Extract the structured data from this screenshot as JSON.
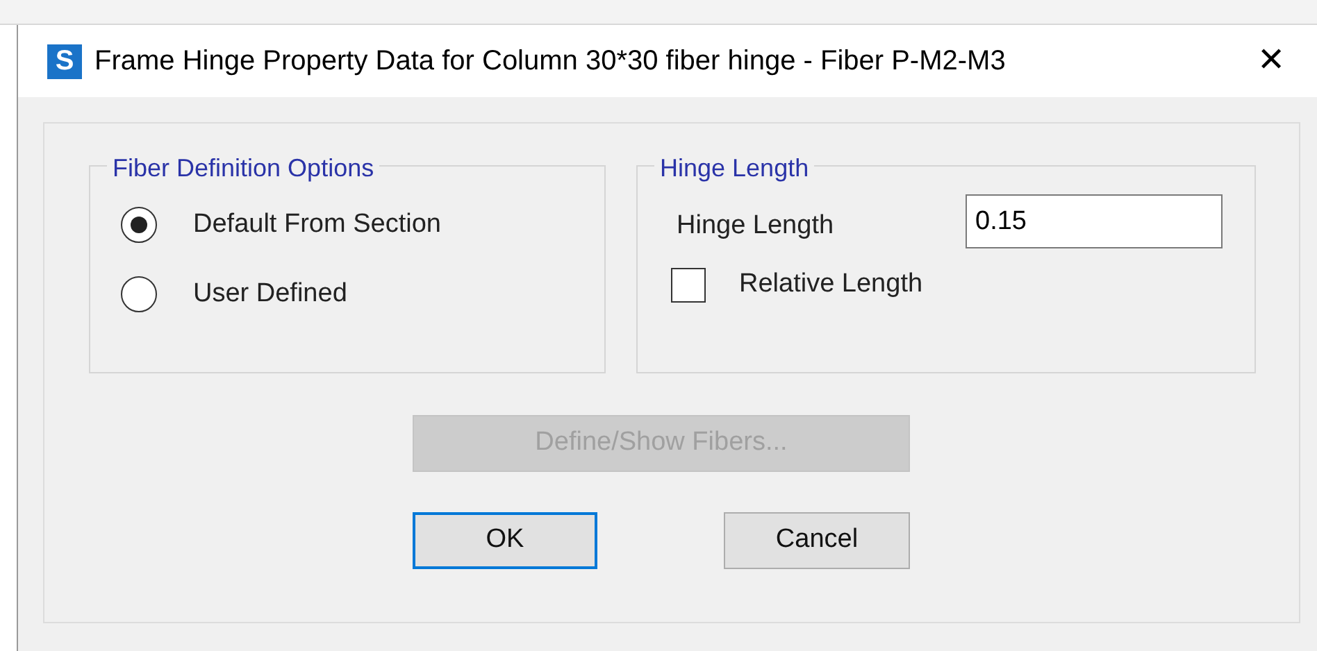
{
  "window": {
    "icon_letter": "S",
    "title": "Frame Hinge Property Data for Column 30*30 fiber hinge - Fiber P-M2-M3",
    "close": "✕"
  },
  "fiber_definition_options": {
    "title": "Fiber Definition Options",
    "options": [
      {
        "label": "Default From Section",
        "selected": true
      },
      {
        "label": "User Defined",
        "selected": false
      }
    ]
  },
  "hinge_length": {
    "title": "Hinge Length",
    "field_label": "Hinge Length",
    "value": "0.15",
    "relative_length": {
      "label": "Relative Length",
      "checked": false
    }
  },
  "buttons": [
    {
      "label": "Define/Show Fibers...",
      "disabled": true,
      "default": false
    },
    {
      "label": "OK",
      "disabled": false,
      "default": true
    },
    {
      "label": "Cancel",
      "disabled": false,
      "default": false
    }
  ]
}
